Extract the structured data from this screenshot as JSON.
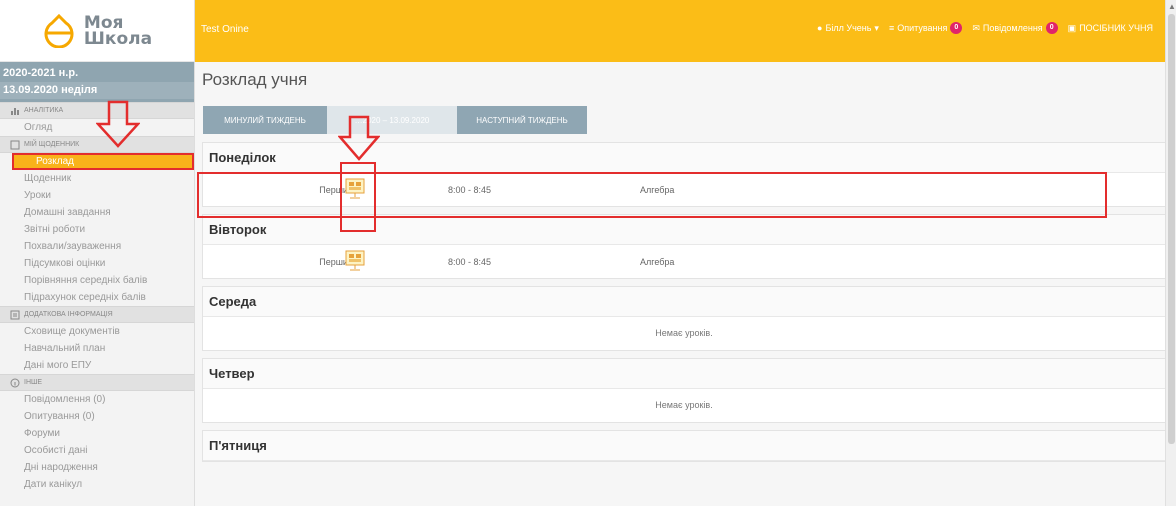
{
  "app": {
    "logo_line1": "Моя",
    "logo_line2": "Школа",
    "top_title": "Test Onine"
  },
  "sidebar": {
    "year": "2020-2021 н.р.",
    "date": "13.09.2020 неділя",
    "sections": [
      {
        "title": "АНАЛІТИКА",
        "items": [
          "Огляд"
        ]
      },
      {
        "title": "МІЙ ЩОДЕННИК",
        "items": [
          "Розклад",
          "Щоденник",
          "Уроки",
          "Домашні завдання",
          "Звітні роботи",
          "Похвали/зауваження",
          "Підсумкові оцінки",
          "Порівняння середніх балів",
          "Підрахунок середніх балів"
        ]
      },
      {
        "title": "ДОДАТКОВА ІНФОРМАЦІЯ",
        "items": [
          "Сховище документів",
          "Навчальний план",
          "Дані мого ЕПУ"
        ]
      },
      {
        "title": "ІНШЕ",
        "items": [
          "Повідомлення (0)",
          "Опитування (0)",
          "Форуми",
          "Особисті дані",
          "Дні народження",
          "Дати канікул"
        ]
      }
    ]
  },
  "topbar": {
    "user": "Білл Учень",
    "surveys": "Опитування",
    "surveys_count": "0",
    "messages": "Повідомлення",
    "messages_count": "0",
    "guide": "ПОСІБНИК УЧНЯ"
  },
  "main": {
    "title": "Розклад учня",
    "week_prev": "МИНУЛИЙ ТИЖДЕНЬ",
    "week_current": "…2020 – 13.09.2020",
    "week_next": "НАСТУПНИЙ ТИЖДЕНЬ",
    "days": [
      {
        "name": "Понеділок",
        "lessons": [
          {
            "num": "Перший",
            "time": "8:00 - 8:45",
            "subject": "Алгебра"
          }
        ]
      },
      {
        "name": "Вівторок",
        "lessons": [
          {
            "num": "Перший",
            "time": "8:00 - 8:45",
            "subject": "Алгебра"
          }
        ]
      },
      {
        "name": "Середа",
        "empty": "Немає уроків."
      },
      {
        "name": "Четвер",
        "empty": "Немає уроків."
      },
      {
        "name": "П'ятниця"
      }
    ]
  },
  "colors": {
    "accent": "#fbbd17",
    "active": "#f9b31a",
    "annotation": "#e32d2d",
    "sidebar_date": "#8fa5b0"
  }
}
